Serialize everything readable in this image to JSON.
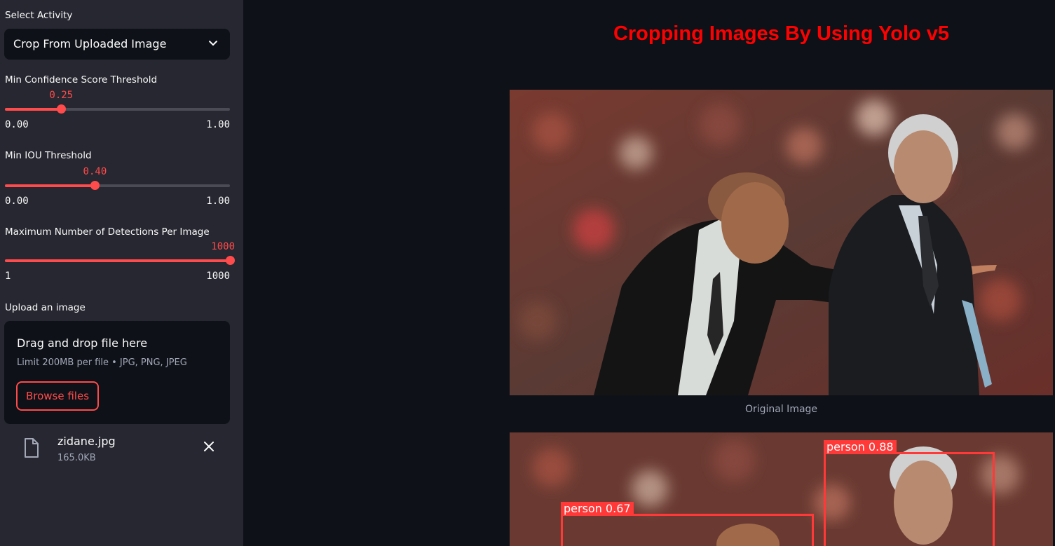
{
  "sidebar": {
    "activity_label": "Select Activity",
    "activity_value": "Crop From Uploaded Image",
    "sliders": [
      {
        "label": "Min Confidence Score Threshold",
        "value": "0.25",
        "min": "0.00",
        "max": "1.00",
        "fraction": 0.25
      },
      {
        "label": "Min IOU Threshold",
        "value": "0.40",
        "min": "0.00",
        "max": "1.00",
        "fraction": 0.4
      },
      {
        "label": "Maximum Number of Detections Per Image",
        "value": "1000",
        "min": "1",
        "max": "1000",
        "fraction": 1.0
      }
    ],
    "upload": {
      "label": "Upload an image",
      "drop_text": "Drag and drop file here",
      "limit_text": "Limit 200MB per file • JPG, PNG, JPEG",
      "browse_label": "Browse files"
    },
    "file": {
      "name": "zidane.jpg",
      "size": "165.0KB"
    }
  },
  "main": {
    "title": "Cropping Images By Using Yolo v5",
    "caption": "Original Image",
    "detections": [
      {
        "label": "person 0.88"
      },
      {
        "label": "person 0.67"
      }
    ]
  },
  "colors": {
    "accent": "#ff4b4b",
    "title": "#ff0000",
    "box": "#ff3838",
    "sidebar_bg": "#262730",
    "main_bg": "#0e1117"
  }
}
